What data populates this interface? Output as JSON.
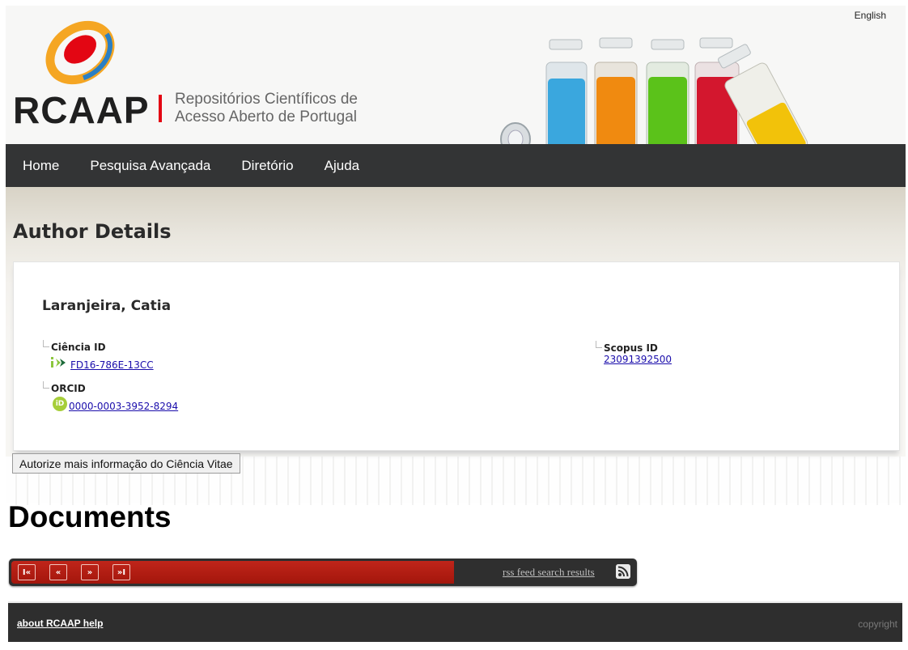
{
  "header": {
    "language_link": "English",
    "logo_text": "RCAAP",
    "tagline_line1": "Repositórios Científicos de",
    "tagline_line2": "Acesso Aberto de Portugal"
  },
  "nav": {
    "items": [
      {
        "label": "Home"
      },
      {
        "label": "Pesquisa Avançada"
      },
      {
        "label": "Diretório"
      },
      {
        "label": "Ajuda"
      }
    ]
  },
  "main": {
    "page_title": "Author Details",
    "author_name": "Laranjeira, Catia",
    "ciencia_label": "Ciência ID",
    "ciencia_value": " FD16-786E-13CC",
    "orcid_label": "ORCID",
    "orcid_value": " 0000-0003-3952-8294",
    "scopus_label": "Scopus ID",
    "scopus_value": "23091392500",
    "autorize_button": "Autorize mais informação do Ciência Vitae",
    "documents_title": "Documents"
  },
  "pager": {
    "first": "I«",
    "prev": "«",
    "next": "»",
    "last": "»I",
    "rss_text": "rss feed search results"
  },
  "footer": {
    "about_link": "about RCAAP help",
    "copyright": "copyright"
  },
  "colors": {
    "nav_bg": "#333435",
    "accent_red": "#e30613",
    "pager_red": "#b01e14",
    "orcid_green": "#a6ce39",
    "link_blue": "#1a0dab"
  },
  "icons": [
    "rcaap-logo-icon",
    "ciencia-id-icon",
    "orcid-icon",
    "rss-icon"
  ]
}
